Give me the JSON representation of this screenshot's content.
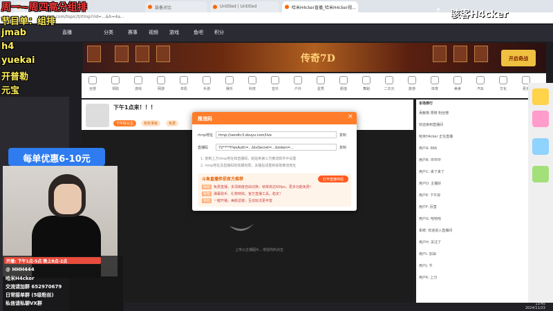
{
  "browser": {
    "tabs": [
      {
        "label": "斗鱼 - 每个人的直播平台"
      },
      {
        "label": "装备对比"
      },
      {
        "label": "Untitled | Untitled"
      },
      {
        "label": "哈米H4cker直播_哈米H4cker视..."
      }
    ],
    "url": "douyu.com/topic/t/rtmp?rid=...&h=4a..."
  },
  "site_nav": {
    "items": [
      "直播",
      "分类",
      "赛事",
      "视频",
      "游戏",
      "鱼吧",
      "积分"
    ]
  },
  "banner": {
    "logo": "传奇7D",
    "button": "开启奇战"
  },
  "categories": [
    "全部",
    "领取",
    "游戏",
    "网游",
    "单机",
    "手游",
    "娱乐",
    "科技",
    "音乐",
    "户外",
    "星秀",
    "颜值",
    "舞蹈",
    "二次元",
    "旅游",
    "体育",
    "美食",
    "汽车",
    "文化",
    "更多"
  ],
  "overlay": {
    "title": "周一~周四高分组排",
    "program": "节目单：组排",
    "names": [
      "jmab",
      "h4",
      "yuekai",
      "开普勒",
      "元宝"
    ],
    "discount": "每单优惠6-10元",
    "hours": "开播: 下午1点-5点 晚上8点-2点",
    "info": [
      "@ HHH444",
      "哈米H4cker",
      "交流请加群 652970679",
      "日常接单群 (5级粉丝)",
      "私信请私聊VX群"
    ],
    "brand": "骇客H4cker"
  },
  "stream": {
    "title": "下午1点来！！！",
    "category": "英雄联盟",
    "tags": [
      "下午好公主",
      "有些事就",
      "免费"
    ]
  },
  "modal": {
    "title": "推流码",
    "server_label": "rtmp地址",
    "server_value": "rtmp://sendtc3.douyu.com/live",
    "key_label": "直播码",
    "key_value": "72****f?wsAuth=...&txSecret=...&token=...",
    "copy_label": "复制",
    "tips": [
      "1. 复制上方rtmp地址和直播码，粘贴到第三方推流软件中设置",
      "2. rtmp地址及直播码有效期有限，关播后请重新获取推流地址"
    ],
    "promo": {
      "title": "斗鱼直播伴侣官方推荐",
      "button": "打开直播伴侣",
      "lines": [
        {
          "tag": "特权",
          "text": "免费直播，多清晰度自由切换，帧率高达60fps，更多功能免费！"
        },
        {
          "tag": "特权",
          "text": "弹幕助手、礼物特效，官方直播工具，稳定！"
        },
        {
          "tag": "特权",
          "text": "一键开播，美颜滤镜，互动玩法更丰富"
        }
      ]
    },
    "video_hint": "上传以主播图片，增强你的点击"
  },
  "chat": {
    "header": "本场排行",
    "lines": [
      "贡献榜  周榜  粉丝榜",
      "欢迎来到直播间",
      "哈米H4cker 正在直播",
      "用户A: 666",
      "用户B: 冲冲冲",
      "用户C: 来了来了",
      "用户D: 主播好",
      "用户E: 下午好",
      "用户F: 厉害",
      "用户G: 哈哈哈",
      "系统: 欢迎进入直播间",
      "用户H: 关注了",
      "用户I: 加油",
      "用户J: 牛",
      "用户K: 上分"
    ]
  },
  "taskbar": {
    "time": "13:45",
    "date": "2024/11/23"
  }
}
